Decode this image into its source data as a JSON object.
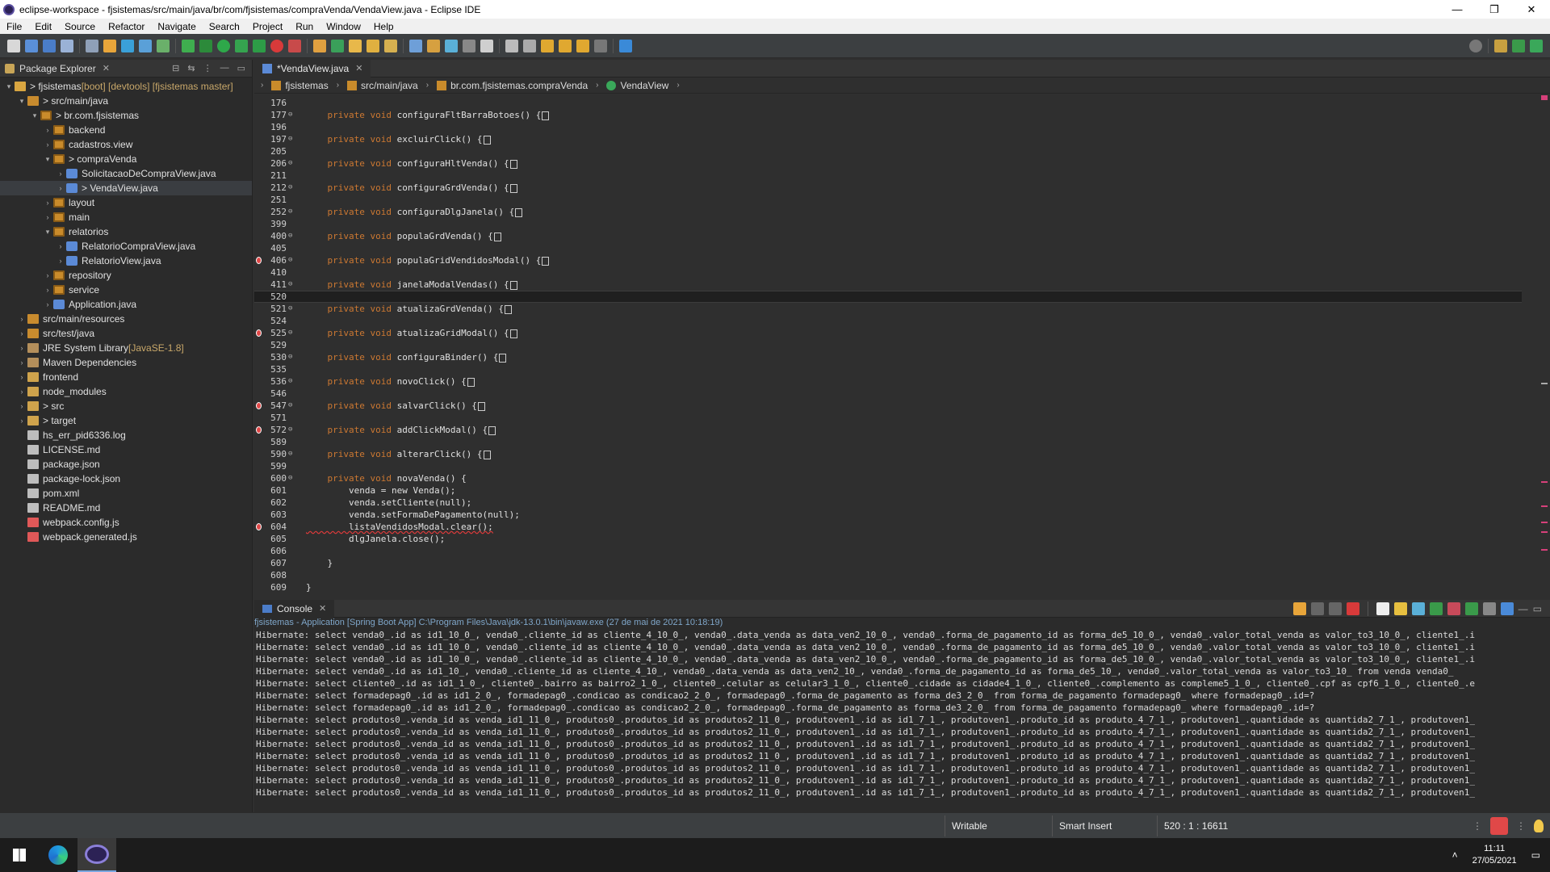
{
  "window": {
    "title": "eclipse-workspace - fjsistemas/src/main/java/br/com/fjsistemas/compraVenda/VendaView.java - Eclipse IDE",
    "minimize": "—",
    "maximize": "❐",
    "close": "✕"
  },
  "menu": [
    "File",
    "Edit",
    "Source",
    "Refactor",
    "Navigate",
    "Search",
    "Project",
    "Run",
    "Window",
    "Help"
  ],
  "explorer": {
    "title": "Package Explorer",
    "tree": [
      {
        "indent": 0,
        "tw": "▾",
        "icon": "proj",
        "label": "> fjsistemas",
        "deco": " [boot] [devtools] [fjsistemas master]"
      },
      {
        "indent": 1,
        "tw": "▾",
        "icon": "srcf",
        "label": "> src/main/java",
        "deco": ""
      },
      {
        "indent": 2,
        "tw": "▾",
        "icon": "pkg",
        "label": "> br.com.fjsistemas",
        "deco": ""
      },
      {
        "indent": 3,
        "tw": "›",
        "icon": "pkg",
        "label": "backend",
        "deco": ""
      },
      {
        "indent": 3,
        "tw": "›",
        "icon": "pkg",
        "label": "cadastros.view",
        "deco": ""
      },
      {
        "indent": 3,
        "tw": "▾",
        "icon": "pkg",
        "label": "> compraVenda",
        "deco": ""
      },
      {
        "indent": 4,
        "tw": "›",
        "icon": "java",
        "label": "SolicitacaoDeCompraView.java",
        "deco": ""
      },
      {
        "indent": 4,
        "tw": "›",
        "icon": "java",
        "label": "> VendaView.java",
        "deco": "",
        "sel": true
      },
      {
        "indent": 3,
        "tw": "›",
        "icon": "pkg",
        "label": "layout",
        "deco": ""
      },
      {
        "indent": 3,
        "tw": "›",
        "icon": "pkg",
        "label": "main",
        "deco": ""
      },
      {
        "indent": 3,
        "tw": "▾",
        "icon": "pkg",
        "label": "relatorios",
        "deco": ""
      },
      {
        "indent": 4,
        "tw": "›",
        "icon": "java",
        "label": "RelatorioCompraView.java",
        "deco": ""
      },
      {
        "indent": 4,
        "tw": "›",
        "icon": "java",
        "label": "RelatorioView.java",
        "deco": ""
      },
      {
        "indent": 3,
        "tw": "›",
        "icon": "pkg",
        "label": "repository",
        "deco": ""
      },
      {
        "indent": 3,
        "tw": "›",
        "icon": "pkg",
        "label": "service",
        "deco": ""
      },
      {
        "indent": 3,
        "tw": "›",
        "icon": "java",
        "label": "Application.java",
        "deco": ""
      },
      {
        "indent": 1,
        "tw": "›",
        "icon": "srcf",
        "label": "src/main/resources",
        "deco": ""
      },
      {
        "indent": 1,
        "tw": "›",
        "icon": "srcf",
        "label": "src/test/java",
        "deco": ""
      },
      {
        "indent": 1,
        "tw": "›",
        "icon": "lib",
        "label": "JRE System Library",
        "deco": " [JavaSE-1.8]"
      },
      {
        "indent": 1,
        "tw": "›",
        "icon": "lib",
        "label": "Maven Dependencies",
        "deco": ""
      },
      {
        "indent": 1,
        "tw": "›",
        "icon": "fold",
        "label": "frontend",
        "deco": ""
      },
      {
        "indent": 1,
        "tw": "›",
        "icon": "fold",
        "label": "node_modules",
        "deco": ""
      },
      {
        "indent": 1,
        "tw": "›",
        "icon": "fold",
        "label": "> src",
        "deco": ""
      },
      {
        "indent": 1,
        "tw": "›",
        "icon": "fold",
        "label": "> target",
        "deco": ""
      },
      {
        "indent": 1,
        "tw": "",
        "icon": "file",
        "label": "hs_err_pid6336.log",
        "deco": ""
      },
      {
        "indent": 1,
        "tw": "",
        "icon": "file",
        "label": "LICENSE.md",
        "deco": ""
      },
      {
        "indent": 1,
        "tw": "",
        "icon": "file",
        "label": "package.json",
        "deco": ""
      },
      {
        "indent": 1,
        "tw": "",
        "icon": "file",
        "label": "package-lock.json",
        "deco": ""
      },
      {
        "indent": 1,
        "tw": "",
        "icon": "file",
        "label": "pom.xml",
        "deco": ""
      },
      {
        "indent": 1,
        "tw": "",
        "icon": "file",
        "label": "README.md",
        "deco": ""
      },
      {
        "indent": 1,
        "tw": "",
        "icon": "jsf",
        "label": "webpack.config.js",
        "deco": ""
      },
      {
        "indent": 1,
        "tw": "",
        "icon": "jsf",
        "label": "webpack.generated.js",
        "deco": ""
      }
    ]
  },
  "editor": {
    "tab": "*VendaView.java",
    "breadcrumb": [
      "fjsistemas",
      "src/main/java",
      "br.com.fjsistemas.compraVenda",
      "VendaView"
    ],
    "lines": [
      {
        "n": "176",
        "fold": "",
        "bp": false,
        "kw": "",
        "fn": "",
        "box": false
      },
      {
        "n": "177",
        "fold": "⊖",
        "bp": false,
        "kw": "    private void ",
        "fn": "configuraFltBarraBotoes() {",
        "box": true
      },
      {
        "n": "196",
        "fold": "",
        "bp": false,
        "kw": "",
        "fn": "",
        "box": false
      },
      {
        "n": "197",
        "fold": "⊖",
        "bp": false,
        "kw": "    private void ",
        "fn": "excluirClick() {",
        "box": true
      },
      {
        "n": "205",
        "fold": "",
        "bp": false,
        "kw": "",
        "fn": "",
        "box": false
      },
      {
        "n": "206",
        "fold": "⊖",
        "bp": false,
        "kw": "    private void ",
        "fn": "configuraHltVenda() {",
        "box": true
      },
      {
        "n": "211",
        "fold": "",
        "bp": false,
        "kw": "",
        "fn": "",
        "box": false
      },
      {
        "n": "212",
        "fold": "⊖",
        "bp": false,
        "kw": "    private void ",
        "fn": "configuraGrdVenda() {",
        "box": true
      },
      {
        "n": "251",
        "fold": "",
        "bp": false,
        "kw": "",
        "fn": "",
        "box": false
      },
      {
        "n": "252",
        "fold": "⊖",
        "bp": false,
        "kw": "    private void ",
        "fn": "configuraDlgJanela() {",
        "box": true
      },
      {
        "n": "399",
        "fold": "",
        "bp": false,
        "kw": "",
        "fn": "",
        "box": false
      },
      {
        "n": "400",
        "fold": "⊖",
        "bp": false,
        "kw": "    private void ",
        "fn": "populaGrdVenda() {",
        "box": true
      },
      {
        "n": "405",
        "fold": "",
        "bp": false,
        "kw": "",
        "fn": "",
        "box": false
      },
      {
        "n": "406",
        "fold": "⊖",
        "bp": true,
        "kw": "    private void ",
        "fn": "populaGridVendidosModal() {",
        "box": true
      },
      {
        "n": "410",
        "fold": "",
        "bp": false,
        "kw": "",
        "fn": "",
        "box": false
      },
      {
        "n": "411",
        "fold": "⊖",
        "bp": false,
        "kw": "    private void ",
        "fn": "janelaModalVendas() {",
        "box": true
      },
      {
        "n": "520",
        "fold": "",
        "bp": false,
        "kw": "",
        "fn": "",
        "box": false,
        "cur": true
      },
      {
        "n": "521",
        "fold": "⊖",
        "bp": false,
        "kw": "    private void ",
        "fn": "atualizaGrdVenda() {",
        "box": true
      },
      {
        "n": "524",
        "fold": "",
        "bp": false,
        "kw": "",
        "fn": "",
        "box": false
      },
      {
        "n": "525",
        "fold": "⊖",
        "bp": true,
        "kw": "    private void ",
        "fn": "atualizaGridModal() {",
        "box": true
      },
      {
        "n": "529",
        "fold": "",
        "bp": false,
        "kw": "",
        "fn": "",
        "box": false
      },
      {
        "n": "530",
        "fold": "⊖",
        "bp": false,
        "kw": "    private void ",
        "fn": "configuraBinder() {",
        "box": true
      },
      {
        "n": "535",
        "fold": "",
        "bp": false,
        "kw": "",
        "fn": "",
        "box": false
      },
      {
        "n": "536",
        "fold": "⊖",
        "bp": false,
        "kw": "    private void ",
        "fn": "novoClick() {",
        "box": true
      },
      {
        "n": "546",
        "fold": "",
        "bp": false,
        "kw": "",
        "fn": "",
        "box": false
      },
      {
        "n": "547",
        "fold": "⊖",
        "bp": true,
        "kw": "    private void ",
        "fn": "salvarClick() {",
        "box": true
      },
      {
        "n": "571",
        "fold": "",
        "bp": false,
        "kw": "",
        "fn": "",
        "box": false
      },
      {
        "n": "572",
        "fold": "⊖",
        "bp": true,
        "kw": "    private void ",
        "fn": "addClickModal() {",
        "box": true
      },
      {
        "n": "589",
        "fold": "",
        "bp": false,
        "kw": "",
        "fn": "",
        "box": false
      },
      {
        "n": "590",
        "fold": "⊖",
        "bp": false,
        "kw": "    private void ",
        "fn": "alterarClick() {",
        "box": true
      },
      {
        "n": "599",
        "fold": "",
        "bp": false,
        "kw": "",
        "fn": "",
        "box": false
      },
      {
        "n": "600",
        "fold": "⊖",
        "bp": false,
        "kw": "    private void ",
        "fn": "novaVenda() {",
        "box": false
      },
      {
        "n": "601",
        "fold": "",
        "bp": false,
        "kw": "",
        "fn": "        venda = new Venda();",
        "box": false
      },
      {
        "n": "602",
        "fold": "",
        "bp": false,
        "kw": "",
        "fn": "        venda.setCliente(null);",
        "box": false
      },
      {
        "n": "603",
        "fold": "",
        "bp": false,
        "kw": "",
        "fn": "        venda.setFormaDePagamento(null);",
        "box": false
      },
      {
        "n": "604",
        "fold": "",
        "bp": true,
        "kw": "",
        "fn": "        listaVendidosModal.clear();",
        "box": false
      },
      {
        "n": "605",
        "fold": "",
        "bp": false,
        "kw": "",
        "fn": "        dlgJanela.close();",
        "box": false
      },
      {
        "n": "606",
        "fold": "",
        "bp": false,
        "kw": "",
        "fn": "",
        "box": false
      },
      {
        "n": "607",
        "fold": "",
        "bp": false,
        "kw": "",
        "fn": "    }",
        "box": false
      },
      {
        "n": "608",
        "fold": "",
        "bp": false,
        "kw": "",
        "fn": "",
        "box": false
      },
      {
        "n": "609",
        "fold": "",
        "bp": false,
        "kw": "",
        "fn": "}",
        "box": false
      }
    ]
  },
  "console": {
    "tab": "Console",
    "header": "fjsistemas - Application [Spring Boot App] C:\\Program Files\\Java\\jdk-13.0.1\\bin\\javaw.exe  (27 de mai de 2021 10:18:19)",
    "lines": [
      "Hibernate: select venda0_.id as id1_10_0_, venda0_.cliente_id as cliente_4_10_0_, venda0_.data_venda as data_ven2_10_0_, venda0_.forma_de_pagamento_id as forma_de5_10_0_, venda0_.valor_total_venda as valor_to3_10_0_, cliente1_.i",
      "Hibernate: select venda0_.id as id1_10_0_, venda0_.cliente_id as cliente_4_10_0_, venda0_.data_venda as data_ven2_10_0_, venda0_.forma_de_pagamento_id as forma_de5_10_0_, venda0_.valor_total_venda as valor_to3_10_0_, cliente1_.i",
      "Hibernate: select venda0_.id as id1_10_0_, venda0_.cliente_id as cliente_4_10_0_, venda0_.data_venda as data_ven2_10_0_, venda0_.forma_de_pagamento_id as forma_de5_10_0_, venda0_.valor_total_venda as valor_to3_10_0_, cliente1_.i",
      "Hibernate: select venda0_.id as id1_10_, venda0_.cliente_id as cliente_4_10_, venda0_.data_venda as data_ven2_10_, venda0_.forma_de_pagamento_id as forma_de5_10_, venda0_.valor_total_venda as valor_to3_10_ from venda venda0_",
      "Hibernate: select cliente0_.id as id1_1_0_, cliente0_.bairro as bairro2_1_0_, cliente0_.celular as celular3_1_0_, cliente0_.cidade as cidade4_1_0_, cliente0_.complemento as compleme5_1_0_, cliente0_.cpf as cpf6_1_0_, cliente0_.e",
      "Hibernate: select formadepag0_.id as id1_2_0_, formadepag0_.condicao as condicao2_2_0_, formadepag0_.forma_de_pagamento as forma_de3_2_0_ from forma_de_pagamento formadepag0_ where formadepag0_.id=?",
      "Hibernate: select formadepag0_.id as id1_2_0_, formadepag0_.condicao as condicao2_2_0_, formadepag0_.forma_de_pagamento as forma_de3_2_0_ from forma_de_pagamento formadepag0_ where formadepag0_.id=?",
      "Hibernate: select produtos0_.venda_id as venda_id1_11_0_, produtos0_.produtos_id as produtos2_11_0_, produtoven1_.id as id1_7_1_, produtoven1_.produto_id as produto_4_7_1_, produtoven1_.quantidade as quantida2_7_1_, produtoven1_",
      "Hibernate: select produtos0_.venda_id as venda_id1_11_0_, produtos0_.produtos_id as produtos2_11_0_, produtoven1_.id as id1_7_1_, produtoven1_.produto_id as produto_4_7_1_, produtoven1_.quantidade as quantida2_7_1_, produtoven1_",
      "Hibernate: select produtos0_.venda_id as venda_id1_11_0_, produtos0_.produtos_id as produtos2_11_0_, produtoven1_.id as id1_7_1_, produtoven1_.produto_id as produto_4_7_1_, produtoven1_.quantidade as quantida2_7_1_, produtoven1_",
      "Hibernate: select produtos0_.venda_id as venda_id1_11_0_, produtos0_.produtos_id as produtos2_11_0_, produtoven1_.id as id1_7_1_, produtoven1_.produto_id as produto_4_7_1_, produtoven1_.quantidade as quantida2_7_1_, produtoven1_",
      "Hibernate: select produtos0_.venda_id as venda_id1_11_0_, produtos0_.produtos_id as produtos2_11_0_, produtoven1_.id as id1_7_1_, produtoven1_.produto_id as produto_4_7_1_, produtoven1_.quantidade as quantida2_7_1_, produtoven1_",
      "Hibernate: select produtos0_.venda_id as venda_id1_11_0_, produtos0_.produtos_id as produtos2_11_0_, produtoven1_.id as id1_7_1_, produtoven1_.produto_id as produto_4_7_1_, produtoven1_.quantidade as quantida2_7_1_, produtoven1_",
      "Hibernate: select produtos0_.venda_id as venda_id1_11_0_, produtos0_.produtos_id as produtos2_11_0_, produtoven1_.id as id1_7_1_, produtoven1_.produto_id as produto_4_7_1_, produtoven1_.quantidade as quantida2_7_1_, produtoven1_"
    ]
  },
  "status": {
    "writable": "Writable",
    "insert": "Smart Insert",
    "position": "520 : 1 : 16611"
  },
  "taskbar": {
    "time": "11:11",
    "date": "27/05/2021"
  }
}
